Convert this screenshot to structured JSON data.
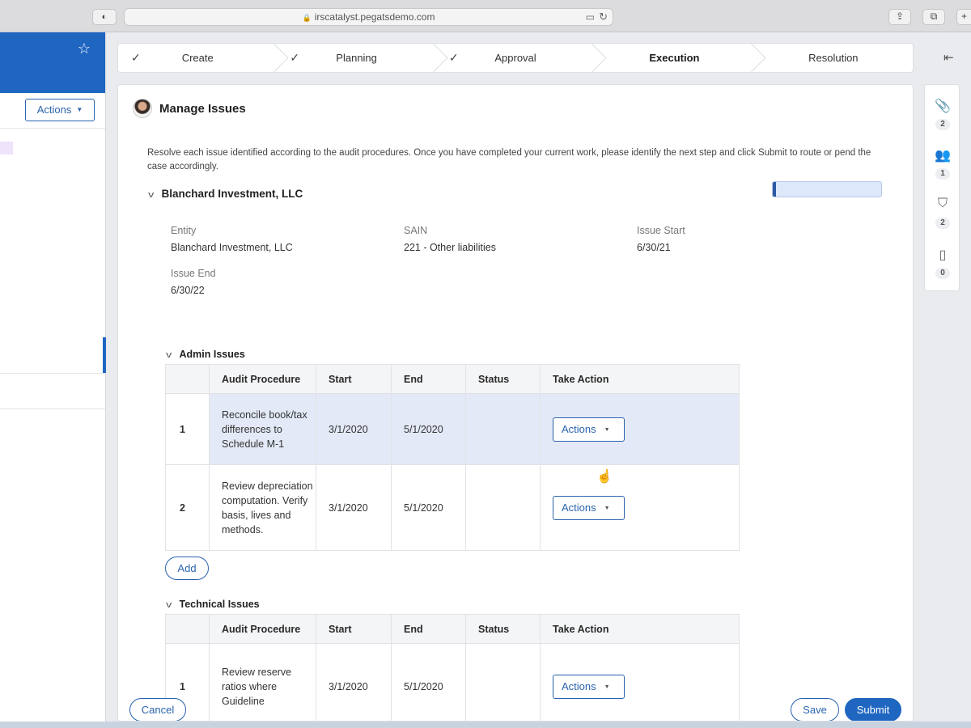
{
  "browser": {
    "url": "irscatalyst.pegatsdemo.com"
  },
  "left_panel": {
    "actions_label": "Actions"
  },
  "stepper": {
    "steps": [
      {
        "label": "Create",
        "done": true
      },
      {
        "label": "Planning",
        "done": true
      },
      {
        "label": "Approval",
        "done": true
      },
      {
        "label": "Execution",
        "current": true
      },
      {
        "label": "Resolution"
      }
    ]
  },
  "main": {
    "title": "Manage Issues",
    "instructions": "Resolve each issue identified according to the audit procedures. Once you have completed your current work, please identify the next step and click Submit to route or pend the case accordingly.",
    "entity_section": {
      "heading": "Blanchard Investment, LLC",
      "progress": 0.03,
      "fields": {
        "entity_label": "Entity",
        "entity_value": "Blanchard Investment, LLC",
        "sain_label": "SAIN",
        "sain_value": "221 - Other liabilities",
        "issue_start_label": "Issue Start",
        "issue_start_value": "6/30/21",
        "issue_end_label": "Issue End",
        "issue_end_value": "6/30/22"
      }
    },
    "columns": [
      "",
      "Audit Procedure",
      "Start",
      "End",
      "Status",
      "Take Action"
    ],
    "admin_issues": {
      "heading": "Admin Issues",
      "rows": [
        {
          "num": "1",
          "procedure": "Reconcile book/tax differences to Schedule M-1",
          "start": "3/1/2020",
          "end": "5/1/2020",
          "status": "",
          "action": "Actions"
        },
        {
          "num": "2",
          "procedure": "Review depreciation computation. Verify basis, lives and methods.",
          "start": "3/1/2020",
          "end": "5/1/2020",
          "status": "",
          "action": "Actions"
        }
      ],
      "add_label": "Add"
    },
    "technical_issues": {
      "heading": "Technical Issues",
      "rows": [
        {
          "num": "1",
          "procedure": "Review reserve ratios where Guideline",
          "start": "3/1/2020",
          "end": "5/1/2020",
          "status": "",
          "action": "Actions"
        }
      ]
    },
    "footer": {
      "cancel": "Cancel",
      "save": "Save",
      "submit": "Submit"
    }
  },
  "utility_rail": {
    "attachments_count": "2",
    "followers_count": "1",
    "tags_count": "2",
    "notes_count": "0"
  },
  "colors": {
    "brand_blue": "#1f66c1",
    "highlight_row": "#e3e9f6"
  }
}
